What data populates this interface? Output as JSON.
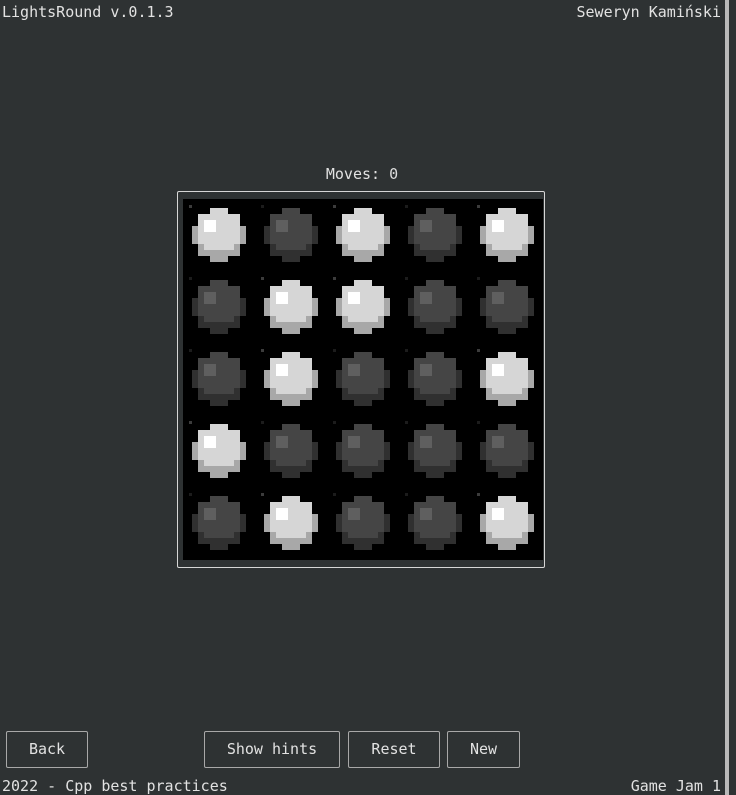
{
  "header": {
    "app_title": "LightsRound v.0.1.3",
    "author": "Seweryn Kamiński"
  },
  "game": {
    "moves_label": "Moves: ",
    "moves_count": "0",
    "grid": [
      [
        1,
        0,
        1,
        0,
        1
      ],
      [
        0,
        1,
        1,
        0,
        0
      ],
      [
        0,
        1,
        0,
        0,
        1
      ],
      [
        1,
        0,
        0,
        0,
        0
      ],
      [
        0,
        1,
        0,
        0,
        1
      ]
    ]
  },
  "buttons": {
    "back": "Back",
    "show_hints": "Show hints",
    "reset": "Reset",
    "new": "New"
  },
  "footer": {
    "left": "2022 - Cpp best practices",
    "right": "Game Jam 1"
  },
  "colors": {
    "background": "#2e3233",
    "board": "#000000",
    "light_on": "#e2e2e2",
    "light_off": "#4a4a4a"
  }
}
